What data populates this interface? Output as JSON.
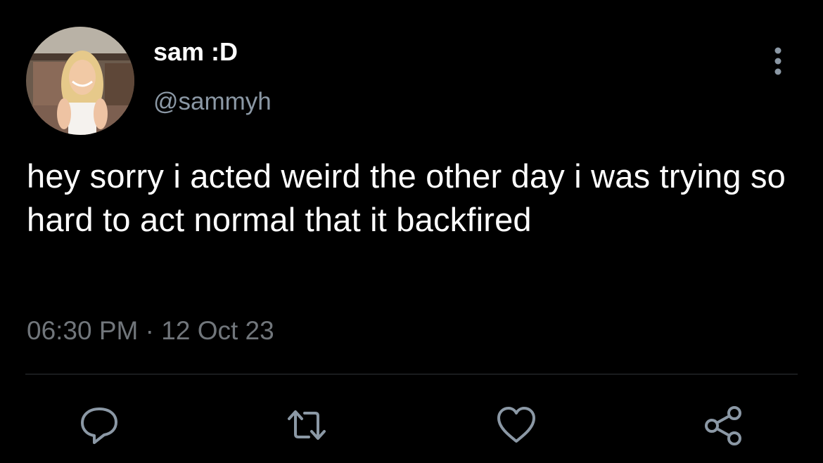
{
  "user": {
    "display_name": "sam :D",
    "handle": "@sammyh",
    "avatar_alt": "profile-photo"
  },
  "tweet": {
    "text": "hey sorry i acted weird the other day i was trying so hard to act normal that it backfired",
    "time": "06:30 PM",
    "separator": "·",
    "date": "12 Oct 23"
  },
  "actions": {
    "reply_icon": "reply-icon",
    "retweet_icon": "retweet-icon",
    "like_icon": "heart-icon",
    "share_icon": "share-icon",
    "more_icon": "more-vertical-icon"
  },
  "colors": {
    "background": "#000000",
    "text": "#ffffff",
    "secondary_text": "#8b98a5",
    "icon": "#8b98a5",
    "divider": "#2f3336"
  }
}
